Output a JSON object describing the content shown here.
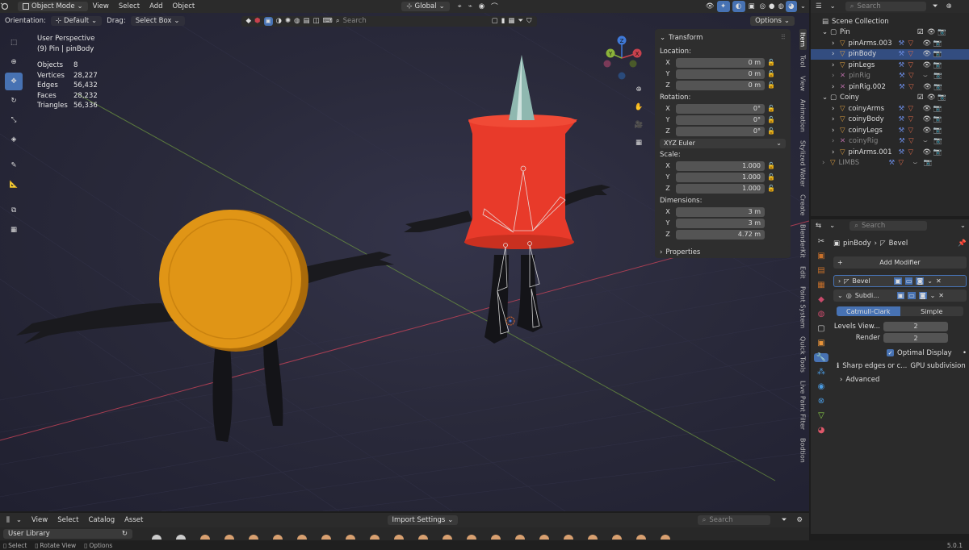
{
  "top_header": {
    "mode": "Object Mode",
    "menus": [
      "View",
      "Select",
      "Add",
      "Object"
    ],
    "transform_orientation": "Global",
    "search_placeholder": "Search"
  },
  "tool_header": {
    "orientation_label": "Orientation:",
    "orientation_value": "Default",
    "drag_label": "Drag:",
    "drag_value": "Select Box",
    "options": "Options",
    "search_placeholder": "Search"
  },
  "viewport_info": {
    "perspective": "User Perspective",
    "context": "(9) Pin | pinBody",
    "stats": [
      {
        "label": "Objects",
        "value": "8"
      },
      {
        "label": "Vertices",
        "value": "28,227"
      },
      {
        "label": "Edges",
        "value": "56,432"
      },
      {
        "label": "Faces",
        "value": "28,232"
      },
      {
        "label": "Triangles",
        "value": "56,336"
      }
    ]
  },
  "gizmo": {
    "z": "Z",
    "y": "Y",
    "x": "X"
  },
  "npanel": {
    "transform_title": "Transform",
    "location_label": "Location:",
    "location": [
      {
        "axis": "X",
        "value": "0 m"
      },
      {
        "axis": "Y",
        "value": "0 m"
      },
      {
        "axis": "Z",
        "value": "0 m"
      }
    ],
    "rotation_label": "Rotation:",
    "rotation": [
      {
        "axis": "X",
        "value": "0°"
      },
      {
        "axis": "Y",
        "value": "0°"
      },
      {
        "axis": "Z",
        "value": "0°"
      }
    ],
    "rotation_mode": "XYZ Euler",
    "scale_label": "Scale:",
    "scale": [
      {
        "axis": "X",
        "value": "1.000"
      },
      {
        "axis": "Y",
        "value": "1.000"
      },
      {
        "axis": "Z",
        "value": "1.000"
      }
    ],
    "dimensions_label": "Dimensions:",
    "dimensions": [
      {
        "axis": "X",
        "value": "3 m"
      },
      {
        "axis": "Y",
        "value": "3 m"
      },
      {
        "axis": "Z",
        "value": "4.72 m"
      }
    ],
    "properties_title": "Properties"
  },
  "vertical_tabs": [
    "Item",
    "Tool",
    "View",
    "Animation",
    "Stylized Water",
    "Create",
    "BlenderKit",
    "Edit",
    "Paint System",
    "Quick Tools",
    "Live Paint Filter",
    "Bodtion"
  ],
  "outliner": {
    "search_placeholder": "Search",
    "root": "Scene Collection",
    "rows": [
      {
        "name": "Pin",
        "level": 1,
        "collection": true
      },
      {
        "name": "pinArms.003",
        "level": 2
      },
      {
        "name": "pinBody",
        "level": 2,
        "active": true
      },
      {
        "name": "pinLegs",
        "level": 2
      },
      {
        "name": "pinRig",
        "level": 2,
        "dim": true
      },
      {
        "name": "pinRig.002",
        "level": 2
      },
      {
        "name": "Coiny",
        "level": 1,
        "collection": true
      },
      {
        "name": "coinyArms",
        "level": 2
      },
      {
        "name": "coinyBody",
        "level": 2
      },
      {
        "name": "coinyLegs",
        "level": 2
      },
      {
        "name": "coinyRig",
        "level": 2,
        "dim": true
      },
      {
        "name": "pinArms.001",
        "level": 2
      },
      {
        "name": "LIMBS",
        "level": 1,
        "dim": true
      }
    ]
  },
  "properties": {
    "search_placeholder": "Search",
    "object_name": "pinBody",
    "modifier_crumb": "Bevel",
    "add_modifier": "Add Modifier",
    "modifiers": [
      "Bevel",
      "Subdi..."
    ],
    "subdiv_type_a": "Catmull-Clark",
    "subdiv_type_b": "Simple",
    "levels_viewport_label": "Levels View...",
    "levels_viewport_value": "2",
    "render_label": "Render",
    "render_value": "2",
    "optimal_display": "Optimal Display",
    "sharp_edges": "Sharp edges or c...",
    "gpu_subdivision": "GPU subdivision",
    "advanced": "Advanced"
  },
  "asset_browser": {
    "menus": [
      "View",
      "Select",
      "Catalog",
      "Asset"
    ],
    "import_settings": "Import Settings",
    "search_placeholder": "Search",
    "library": "User Library"
  },
  "status_bar": {
    "items": [
      "Select",
      "Rotate View",
      "Options"
    ],
    "version": "5.0.1"
  },
  "colors": {
    "accent": "#4772b3",
    "x_axis": "#c8414d",
    "y_axis": "#8bb33a",
    "z_axis": "#3f79d8",
    "coin": "#e09516",
    "pin_body": "#e83a2a"
  }
}
